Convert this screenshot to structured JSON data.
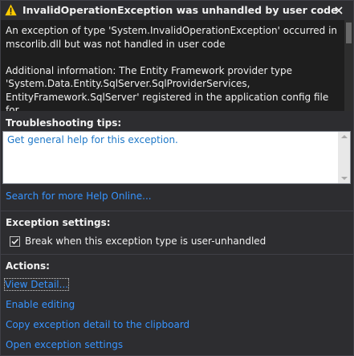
{
  "dialog": {
    "title": "InvalidOperationException was unhandled by user code",
    "icons": {
      "title_icon": "warning-icon",
      "close": "close-icon",
      "checkbox": "checkmark-icon"
    },
    "message": "An exception of type 'System.InvalidOperationException' occurred in mscorlib.dll but was not handled in user code\n\nAdditional information: The Entity Framework provider type 'System.Data.Entity.SqlServer.SqlProviderServices, EntityFramework.SqlServer' registered in the application config file for",
    "troubleshooting": {
      "label": "Troubleshooting tips:",
      "tip_link": "Get general help for this exception."
    },
    "search_link": "Search for more Help Online...",
    "exception_settings": {
      "label": "Exception settings:",
      "checkbox_label": "Break when this exception type is user-unhandled",
      "checked": true
    },
    "actions": {
      "label": "Actions:",
      "items": [
        "View Detail...",
        "Enable editing",
        "Copy exception detail to the clipboard",
        "Open exception settings"
      ]
    },
    "colors": {
      "background": "#2d2d30",
      "message_bg": "#1e1e1e",
      "link": "#3794ff",
      "warning": "#ffcc00"
    }
  }
}
